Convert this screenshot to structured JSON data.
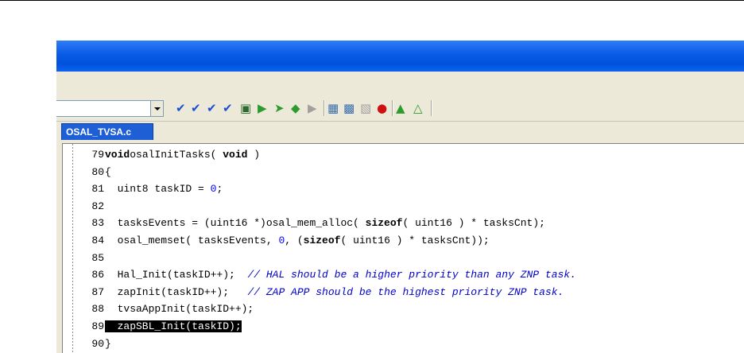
{
  "window": {
    "title": ""
  },
  "toolbar": {
    "buttons": [
      {
        "name": "toggle-bookmark-icon",
        "color": "#1a4fd0",
        "glyph": "✔"
      },
      {
        "name": "next-bookmark-icon",
        "color": "#1a4fd0",
        "glyph": "✔"
      },
      {
        "name": "prev-bookmark-icon",
        "color": "#1a4fd0",
        "glyph": "✔"
      },
      {
        "name": "clear-bookmarks-icon",
        "color": "#1a4fd0",
        "glyph": "✔"
      },
      {
        "name": "file-view-icon",
        "color": "#2d6a2d",
        "glyph": "▣"
      },
      {
        "name": "make-icon",
        "color": "#2e9b2e",
        "glyph": "▶"
      },
      {
        "name": "compile-icon",
        "color": "#2e9b2e",
        "glyph": "➤"
      },
      {
        "name": "rebuild-icon",
        "color": "#2e9b2e",
        "glyph": "◆"
      },
      {
        "name": "stop-build-icon",
        "color": "#a0a0a0",
        "glyph": "▶"
      },
      {
        "name": "workspace-icon",
        "color": "#3a6fb0",
        "glyph": "▦"
      },
      {
        "name": "find-in-files-icon",
        "color": "#3a6fb0",
        "glyph": "▩"
      },
      {
        "name": "disabled-icon",
        "color": "#a0a0a0",
        "glyph": "▧"
      },
      {
        "name": "breakpoint-icon",
        "color": "#d01010",
        "glyph": "●"
      },
      {
        "name": "download-debug-icon",
        "color": "#2e9b2e",
        "glyph": "▲"
      },
      {
        "name": "debug-without-download-icon",
        "color": "#2e9b2e",
        "glyph": "△"
      }
    ]
  },
  "editor": {
    "tab_label": "OSAL_TVSA.c",
    "lines": [
      {
        "num": "79",
        "tokens": [
          [
            "kw",
            "void"
          ],
          [
            "",
            "osalInitTasks( "
          ],
          [
            "kw",
            "void"
          ],
          [
            "",
            " )"
          ]
        ]
      },
      {
        "num": "80",
        "tokens": [
          [
            "",
            "{"
          ]
        ]
      },
      {
        "num": "81",
        "tokens": [
          [
            "",
            "  uint8 taskID = "
          ],
          [
            "num",
            "0"
          ],
          [
            "",
            ";"
          ]
        ]
      },
      {
        "num": "82",
        "tokens": []
      },
      {
        "num": "83",
        "tokens": [
          [
            "",
            "  tasksEvents = (uint16 *)osal_mem_alloc( "
          ],
          [
            "kw",
            "sizeof"
          ],
          [
            "",
            "( uint16 ) * tasksCnt);"
          ]
        ]
      },
      {
        "num": "84",
        "tokens": [
          [
            "",
            "  osal_memset( tasksEvents, "
          ],
          [
            "num",
            "0"
          ],
          [
            "",
            ", ("
          ],
          [
            "kw",
            "sizeof"
          ],
          [
            "",
            "( uint16 ) * tasksCnt));"
          ]
        ]
      },
      {
        "num": "85",
        "tokens": []
      },
      {
        "num": "86",
        "tokens": [
          [
            "",
            "  Hal_Init(taskID++);  "
          ],
          [
            "cmt",
            "// HAL should be a higher priority than any ZNP task."
          ]
        ]
      },
      {
        "num": "87",
        "tokens": [
          [
            "",
            "  zapInit(taskID++);   "
          ],
          [
            "cmt",
            "// ZAP APP should be the highest priority ZNP task."
          ]
        ]
      },
      {
        "num": "88",
        "tokens": [
          [
            "",
            "  tvsaAppInit(taskID++);"
          ]
        ]
      },
      {
        "num": "89",
        "tokens": [
          [
            "hl",
            "  zapSBL_Init(taskID);"
          ]
        ]
      },
      {
        "num": "90",
        "tokens": [
          [
            "",
            "}"
          ]
        ]
      }
    ]
  }
}
